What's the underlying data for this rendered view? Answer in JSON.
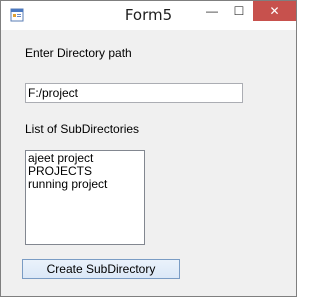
{
  "window": {
    "title": "Form5",
    "controls": {
      "minimize": "—",
      "maximize": "☐",
      "close": "✕"
    },
    "icon": "app-window-icon"
  },
  "form": {
    "path_label": "Enter Directory path",
    "path_value": "F:/project",
    "list_label": "List of SubDirectories",
    "subdirectories": [
      "ajeet project",
      "PROJECTS",
      "running project"
    ],
    "create_button_label": "Create SubDirectory"
  },
  "colors": {
    "close_button": "#c7514d",
    "window_background": "#f0f0f0",
    "button_border": "#7a9cc4"
  }
}
